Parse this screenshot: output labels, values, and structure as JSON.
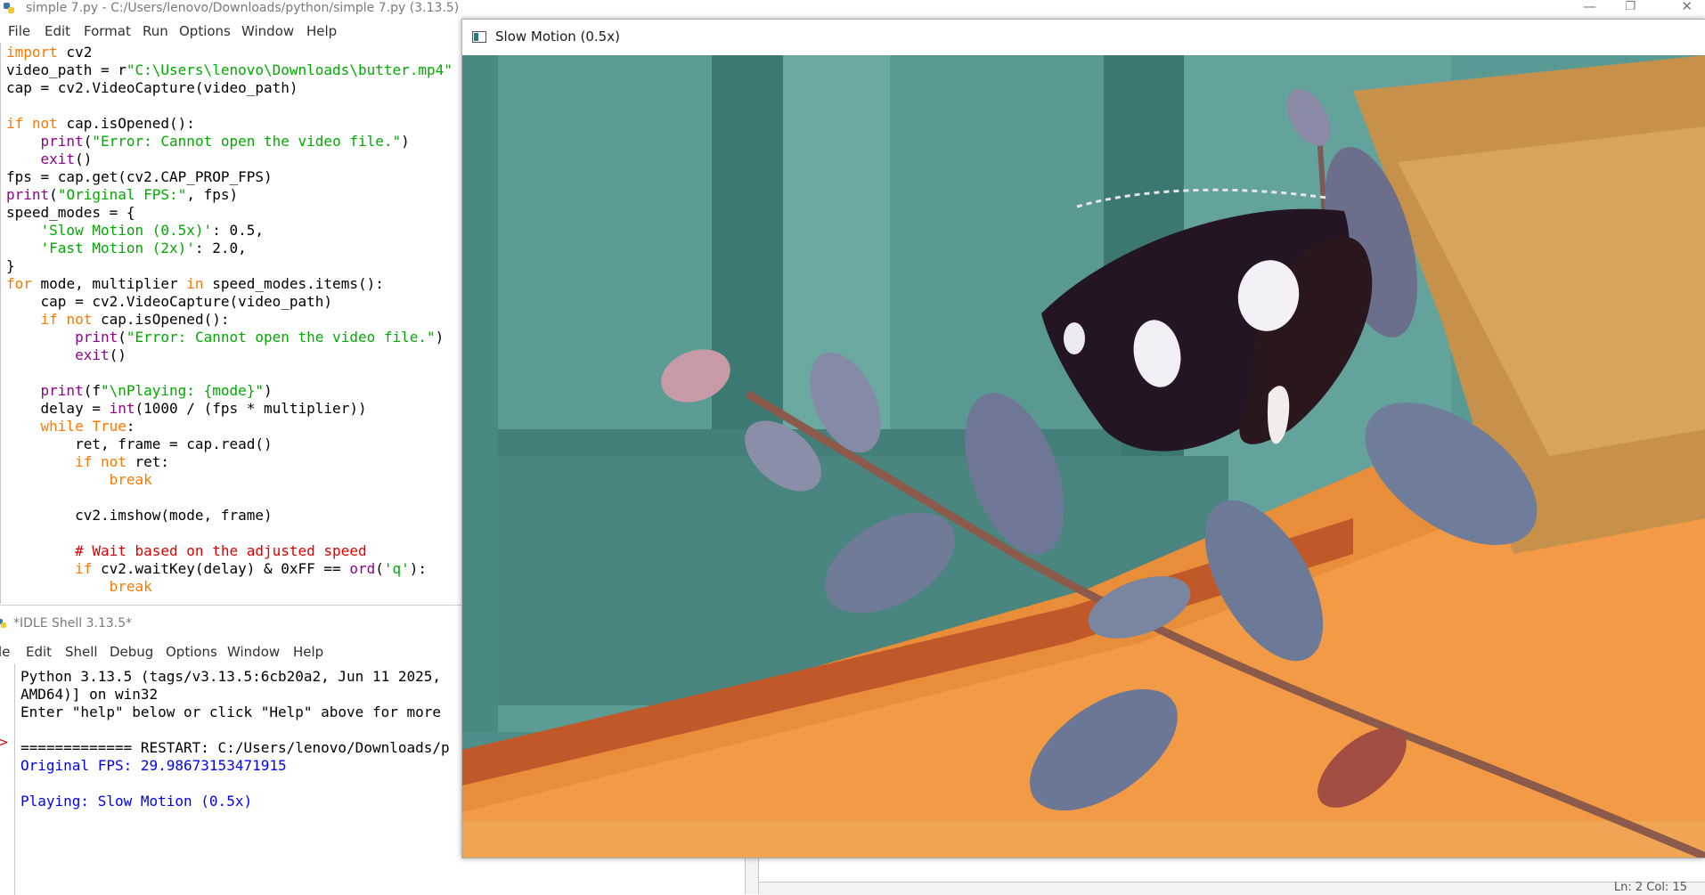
{
  "editor": {
    "title": "simple 7.py - C:/Users/lenovo/Downloads/python/simple 7.py (3.13.5)",
    "menu": [
      "File",
      "Edit",
      "Format",
      "Run",
      "Options",
      "Window",
      "Help"
    ]
  },
  "shell": {
    "title": "*IDLE Shell 3.13.5*",
    "menu": [
      "le",
      "Edit",
      "Shell",
      "Debug",
      "Options",
      "Window",
      "Help"
    ],
    "lines": [
      "Python 3.13.5 (tags/v3.13.5:6cb20a2, Jun 11 2025,",
      "AMD64)] on win32",
      "Enter \"help\" below or click \"Help\" above for more",
      "",
      "============= RESTART: C:/Users/lenovo/Downloads/p",
      "Original FPS: 29.98673153471915",
      "",
      "Playing: Slow Motion (0.5x)"
    ],
    "prompt": ">"
  },
  "video_window": {
    "title": "Slow Motion (0.5x)"
  },
  "status": {
    "position": "Ln: 2   Col: 15"
  },
  "colors": {
    "keyword": "#ff7700",
    "builtin": "#900090",
    "string": "#00aa00",
    "comment": "#dd0000",
    "shell_output": "#0000ff"
  }
}
